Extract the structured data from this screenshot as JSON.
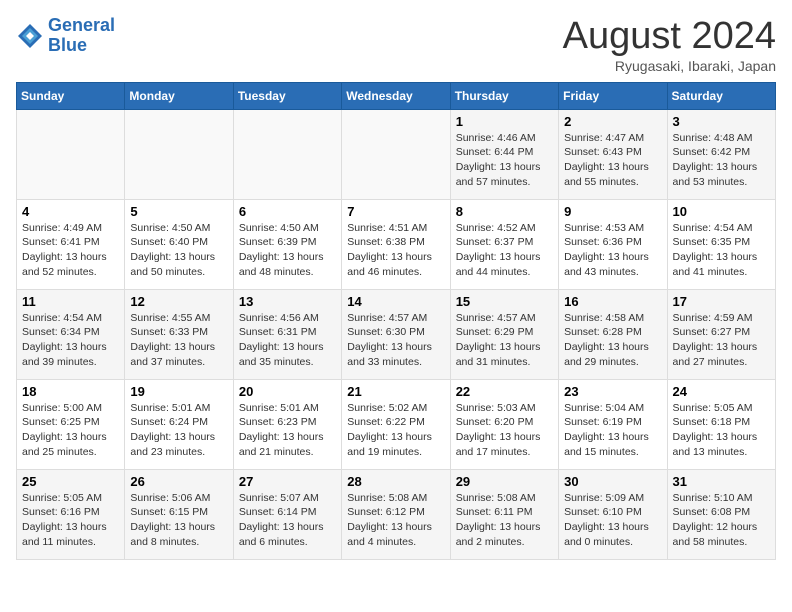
{
  "header": {
    "logo_line1": "General",
    "logo_line2": "Blue",
    "title": "August 2024",
    "subtitle": "Ryugasaki, Ibaraki, Japan"
  },
  "weekdays": [
    "Sunday",
    "Monday",
    "Tuesday",
    "Wednesday",
    "Thursday",
    "Friday",
    "Saturday"
  ],
  "weeks": [
    [
      {
        "day": "",
        "info": ""
      },
      {
        "day": "",
        "info": ""
      },
      {
        "day": "",
        "info": ""
      },
      {
        "day": "",
        "info": ""
      },
      {
        "day": "1",
        "info": "Sunrise: 4:46 AM\nSunset: 6:44 PM\nDaylight: 13 hours\nand 57 minutes."
      },
      {
        "day": "2",
        "info": "Sunrise: 4:47 AM\nSunset: 6:43 PM\nDaylight: 13 hours\nand 55 minutes."
      },
      {
        "day": "3",
        "info": "Sunrise: 4:48 AM\nSunset: 6:42 PM\nDaylight: 13 hours\nand 53 minutes."
      }
    ],
    [
      {
        "day": "4",
        "info": "Sunrise: 4:49 AM\nSunset: 6:41 PM\nDaylight: 13 hours\nand 52 minutes."
      },
      {
        "day": "5",
        "info": "Sunrise: 4:50 AM\nSunset: 6:40 PM\nDaylight: 13 hours\nand 50 minutes."
      },
      {
        "day": "6",
        "info": "Sunrise: 4:50 AM\nSunset: 6:39 PM\nDaylight: 13 hours\nand 48 minutes."
      },
      {
        "day": "7",
        "info": "Sunrise: 4:51 AM\nSunset: 6:38 PM\nDaylight: 13 hours\nand 46 minutes."
      },
      {
        "day": "8",
        "info": "Sunrise: 4:52 AM\nSunset: 6:37 PM\nDaylight: 13 hours\nand 44 minutes."
      },
      {
        "day": "9",
        "info": "Sunrise: 4:53 AM\nSunset: 6:36 PM\nDaylight: 13 hours\nand 43 minutes."
      },
      {
        "day": "10",
        "info": "Sunrise: 4:54 AM\nSunset: 6:35 PM\nDaylight: 13 hours\nand 41 minutes."
      }
    ],
    [
      {
        "day": "11",
        "info": "Sunrise: 4:54 AM\nSunset: 6:34 PM\nDaylight: 13 hours\nand 39 minutes."
      },
      {
        "day": "12",
        "info": "Sunrise: 4:55 AM\nSunset: 6:33 PM\nDaylight: 13 hours\nand 37 minutes."
      },
      {
        "day": "13",
        "info": "Sunrise: 4:56 AM\nSunset: 6:31 PM\nDaylight: 13 hours\nand 35 minutes."
      },
      {
        "day": "14",
        "info": "Sunrise: 4:57 AM\nSunset: 6:30 PM\nDaylight: 13 hours\nand 33 minutes."
      },
      {
        "day": "15",
        "info": "Sunrise: 4:57 AM\nSunset: 6:29 PM\nDaylight: 13 hours\nand 31 minutes."
      },
      {
        "day": "16",
        "info": "Sunrise: 4:58 AM\nSunset: 6:28 PM\nDaylight: 13 hours\nand 29 minutes."
      },
      {
        "day": "17",
        "info": "Sunrise: 4:59 AM\nSunset: 6:27 PM\nDaylight: 13 hours\nand 27 minutes."
      }
    ],
    [
      {
        "day": "18",
        "info": "Sunrise: 5:00 AM\nSunset: 6:25 PM\nDaylight: 13 hours\nand 25 minutes."
      },
      {
        "day": "19",
        "info": "Sunrise: 5:01 AM\nSunset: 6:24 PM\nDaylight: 13 hours\nand 23 minutes."
      },
      {
        "day": "20",
        "info": "Sunrise: 5:01 AM\nSunset: 6:23 PM\nDaylight: 13 hours\nand 21 minutes."
      },
      {
        "day": "21",
        "info": "Sunrise: 5:02 AM\nSunset: 6:22 PM\nDaylight: 13 hours\nand 19 minutes."
      },
      {
        "day": "22",
        "info": "Sunrise: 5:03 AM\nSunset: 6:20 PM\nDaylight: 13 hours\nand 17 minutes."
      },
      {
        "day": "23",
        "info": "Sunrise: 5:04 AM\nSunset: 6:19 PM\nDaylight: 13 hours\nand 15 minutes."
      },
      {
        "day": "24",
        "info": "Sunrise: 5:05 AM\nSunset: 6:18 PM\nDaylight: 13 hours\nand 13 minutes."
      }
    ],
    [
      {
        "day": "25",
        "info": "Sunrise: 5:05 AM\nSunset: 6:16 PM\nDaylight: 13 hours\nand 11 minutes."
      },
      {
        "day": "26",
        "info": "Sunrise: 5:06 AM\nSunset: 6:15 PM\nDaylight: 13 hours\nand 8 minutes."
      },
      {
        "day": "27",
        "info": "Sunrise: 5:07 AM\nSunset: 6:14 PM\nDaylight: 13 hours\nand 6 minutes."
      },
      {
        "day": "28",
        "info": "Sunrise: 5:08 AM\nSunset: 6:12 PM\nDaylight: 13 hours\nand 4 minutes."
      },
      {
        "day": "29",
        "info": "Sunrise: 5:08 AM\nSunset: 6:11 PM\nDaylight: 13 hours\nand 2 minutes."
      },
      {
        "day": "30",
        "info": "Sunrise: 5:09 AM\nSunset: 6:10 PM\nDaylight: 13 hours\nand 0 minutes."
      },
      {
        "day": "31",
        "info": "Sunrise: 5:10 AM\nSunset: 6:08 PM\nDaylight: 12 hours\nand 58 minutes."
      }
    ]
  ]
}
